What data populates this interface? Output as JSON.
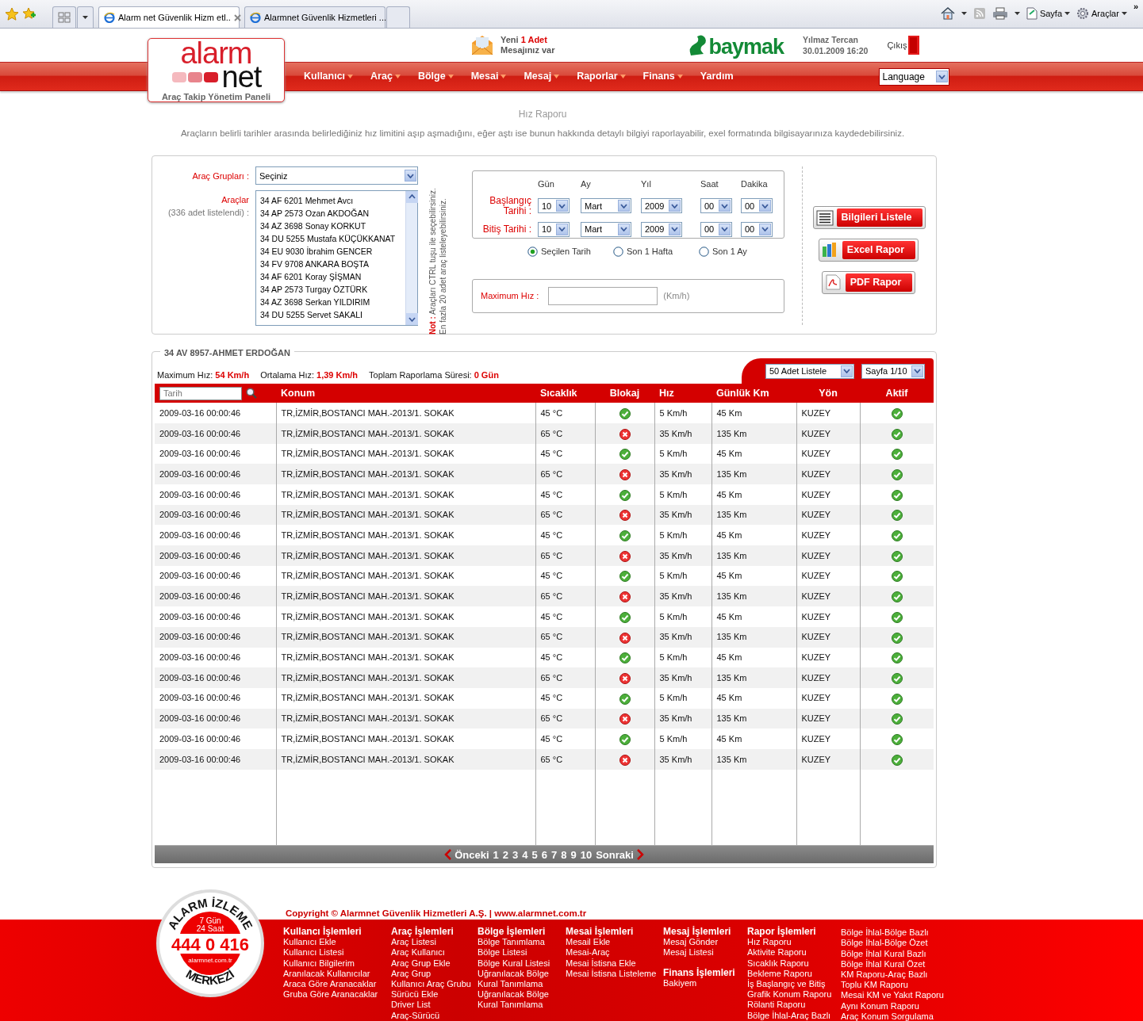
{
  "browser": {
    "tabs": [
      {
        "title": "Alarm net  Güvenlik Hizm etl..",
        "selected": true
      },
      {
        "title": "Alarmnet Güvenlik Hizmetleri ...",
        "selected": false
      }
    ],
    "tools": [
      "Sayfa",
      "Araçlar"
    ],
    "overflow": "»"
  },
  "header": {
    "logo": {
      "top": "alarm",
      "bottom": "net",
      "tagline": "Araç Takip Yönetim Paneli"
    },
    "message": {
      "prefix": "Yeni",
      "count": "1 Adet",
      "line2": "Mesajınız var"
    },
    "partner": "baymak",
    "user": {
      "name": "Yılmaz Tercan",
      "datetime": "30.01.2009 16:20"
    },
    "logout": "Çıkış"
  },
  "nav": {
    "items": [
      {
        "label": "Kullanıcı",
        "has_menu": true
      },
      {
        "label": "Araç",
        "has_menu": true
      },
      {
        "label": "Bölge",
        "has_menu": true
      },
      {
        "label": "Mesai",
        "has_menu": true
      },
      {
        "label": "Mesaj",
        "has_menu": true
      },
      {
        "label": "Raporlar",
        "has_menu": true
      },
      {
        "label": "Finans",
        "has_menu": true
      },
      {
        "label": "Yardım",
        "has_menu": false
      }
    ],
    "language": "Language"
  },
  "page": {
    "title": "Hız Raporu",
    "description": "Araçların belirli tarihler arasında belirlediğiniz hız limitini aşıp aşmadığını, eğer aştı ise bunun hakkında detaylı bilgiyi raporlayabilir, exel formatında bilgisayarınıza kaydedebilirsiniz."
  },
  "filter": {
    "groups_label": "Araç Grupları :",
    "groups_value": "Seçiniz",
    "vehicles_label": "Araçlar",
    "vehicles_count": "(336 adet listelendi) :",
    "vehicles": [
      "34 AF 6201 Mehmet Avcı",
      "34 AP 2573 Ozan AKDOĞAN",
      "34 AZ 3698 Sonay KORKUT",
      "34 DU 5255 Mustafa KÜÇÜKKANAT",
      "34 EU 9030 İbrahim GENCER",
      "34 FV 9708 ANKARA BOŞTA",
      "34 AF 6201 Koray ŞİŞMAN",
      "34 AP 2573 Turgay ÖZTÜRK",
      "34 AZ 3698 Serkan YILDIRIM",
      "34 DU 5255 Servet SAKALI"
    ],
    "note": [
      "**Not :** Araçları CTRL tuşu ile seçebilirsiniz.",
      "En fazla 20 adet araç listeleyebilirsiniz."
    ],
    "date_columns": [
      "Gün",
      "Ay",
      "Yıl",
      "Saat",
      "Dakika"
    ],
    "start_label": "Başlangıç Tarihi :",
    "start": [
      "10",
      "Mart",
      "2009",
      "00",
      "00"
    ],
    "end_label": "Bitiş Tarihi :",
    "end": [
      "10",
      "Mart",
      "2009",
      "00",
      "00"
    ],
    "ranges": [
      {
        "label": "Seçilen Tarih",
        "selected": true
      },
      {
        "label": "Son 1 Hafta",
        "selected": false
      },
      {
        "label": "Son 1 Ay",
        "selected": false
      }
    ],
    "max_speed_label": "Maximum Hız :",
    "max_speed_unit": "(Km/h)",
    "buttons": [
      {
        "kind": "list",
        "label": "Bilgileri Listele"
      },
      {
        "kind": "excel",
        "label": "Excel Rapor"
      },
      {
        "kind": "pdf",
        "label": "PDF Rapor"
      }
    ]
  },
  "results": {
    "title": "34 AV 8957-AHMET ERDOĞAN",
    "stats": [
      {
        "label": "Maximum Hız:",
        "value": "54 Km/h"
      },
      {
        "label": "Ortalama Hız:",
        "value": "1,39 Km/h"
      },
      {
        "label": "Toplam Raporlama Süresi:",
        "value": "0 Gün"
      }
    ],
    "page_size": "50 Adet Listele",
    "page_select": "Sayfa 1/10",
    "search_placeholder": "Tarih",
    "columns": [
      "Konum",
      "Sıcaklık",
      "Blokaj",
      "Hız",
      "Günlük Km",
      "Yön",
      "Aktif"
    ],
    "rows": [
      {
        "date": "2009-03-16 00:00:46",
        "location": "TR,İZMİR,BOSTANCI MAH.-2013/1. SOKAK",
        "temp": "45 °C",
        "blocked": false,
        "speed": "5 Km/h",
        "km": "45 Km",
        "direction": "KUZEY",
        "active": true
      },
      {
        "date": "2009-03-16 00:00:46",
        "location": "TR,İZMİR,BOSTANCI MAH.-2013/1. SOKAK",
        "temp": "65 °C",
        "blocked": true,
        "speed": "35 Km/h",
        "km": "135 Km",
        "direction": "KUZEY",
        "active": true
      },
      {
        "date": "2009-03-16 00:00:46",
        "location": "TR,İZMİR,BOSTANCI MAH.-2013/1. SOKAK",
        "temp": "45 °C",
        "blocked": false,
        "speed": "5 Km/h",
        "km": "45 Km",
        "direction": "KUZEY",
        "active": true
      },
      {
        "date": "2009-03-16 00:00:46",
        "location": "TR,İZMİR,BOSTANCI MAH.-2013/1. SOKAK",
        "temp": "65 °C",
        "blocked": true,
        "speed": "35 Km/h",
        "km": "135 Km",
        "direction": "KUZEY",
        "active": true
      },
      {
        "date": "2009-03-16 00:00:46",
        "location": "TR,İZMİR,BOSTANCI MAH.-2013/1. SOKAK",
        "temp": "45 °C",
        "blocked": false,
        "speed": "5 Km/h",
        "km": "45 Km",
        "direction": "KUZEY",
        "active": true
      },
      {
        "date": "2009-03-16 00:00:46",
        "location": "TR,İZMİR,BOSTANCI MAH.-2013/1. SOKAK",
        "temp": "65 °C",
        "blocked": true,
        "speed": "35 Km/h",
        "km": "135 Km",
        "direction": "KUZEY",
        "active": true
      },
      {
        "date": "2009-03-16 00:00:46",
        "location": "TR,İZMİR,BOSTANCI MAH.-2013/1. SOKAK",
        "temp": "45 °C",
        "blocked": false,
        "speed": "5 Km/h",
        "km": "45 Km",
        "direction": "KUZEY",
        "active": true
      },
      {
        "date": "2009-03-16 00:00:46",
        "location": "TR,İZMİR,BOSTANCI MAH.-2013/1. SOKAK",
        "temp": "65 °C",
        "blocked": true,
        "speed": "35 Km/h",
        "km": "135 Km",
        "direction": "KUZEY",
        "active": true
      },
      {
        "date": "2009-03-16 00:00:46",
        "location": "TR,İZMİR,BOSTANCI MAH.-2013/1. SOKAK",
        "temp": "45 °C",
        "blocked": false,
        "speed": "5 Km/h",
        "km": "45 Km",
        "direction": "KUZEY",
        "active": true
      },
      {
        "date": "2009-03-16 00:00:46",
        "location": "TR,İZMİR,BOSTANCI MAH.-2013/1. SOKAK",
        "temp": "65 °C",
        "blocked": true,
        "speed": "35 Km/h",
        "km": "135 Km",
        "direction": "KUZEY",
        "active": true
      },
      {
        "date": "2009-03-16 00:00:46",
        "location": "TR,İZMİR,BOSTANCI MAH.-2013/1. SOKAK",
        "temp": "45 °C",
        "blocked": false,
        "speed": "5 Km/h",
        "km": "45 Km",
        "direction": "KUZEY",
        "active": true
      },
      {
        "date": "2009-03-16 00:00:46",
        "location": "TR,İZMİR,BOSTANCI MAH.-2013/1. SOKAK",
        "temp": "65 °C",
        "blocked": true,
        "speed": "35 Km/h",
        "km": "135 Km",
        "direction": "KUZEY",
        "active": true
      },
      {
        "date": "2009-03-16 00:00:46",
        "location": "TR,İZMİR,BOSTANCI MAH.-2013/1. SOKAK",
        "temp": "45 °C",
        "blocked": false,
        "speed": "5 Km/h",
        "km": "45 Km",
        "direction": "KUZEY",
        "active": true
      },
      {
        "date": "2009-03-16 00:00:46",
        "location": "TR,İZMİR,BOSTANCI MAH.-2013/1. SOKAK",
        "temp": "65 °C",
        "blocked": true,
        "speed": "35 Km/h",
        "km": "135 Km",
        "direction": "KUZEY",
        "active": true
      },
      {
        "date": "2009-03-16 00:00:46",
        "location": "TR,İZMİR,BOSTANCI MAH.-2013/1. SOKAK",
        "temp": "45 °C",
        "blocked": false,
        "speed": "5 Km/h",
        "km": "45 Km",
        "direction": "KUZEY",
        "active": true
      },
      {
        "date": "2009-03-16 00:00:46",
        "location": "TR,İZMİR,BOSTANCI MAH.-2013/1. SOKAK",
        "temp": "65 °C",
        "blocked": true,
        "speed": "35 Km/h",
        "km": "135 Km",
        "direction": "KUZEY",
        "active": true
      },
      {
        "date": "2009-03-16 00:00:46",
        "location": "TR,İZMİR,BOSTANCI MAH.-2013/1. SOKAK",
        "temp": "45 °C",
        "blocked": false,
        "speed": "5 Km/h",
        "km": "45 Km",
        "direction": "KUZEY",
        "active": true
      },
      {
        "date": "2009-03-16 00:00:46",
        "location": "TR,İZMİR,BOSTANCI MAH.-2013/1. SOKAK",
        "temp": "65 °C",
        "blocked": true,
        "speed": "35 Km/h",
        "km": "135 Km",
        "direction": "KUZEY",
        "active": true
      }
    ],
    "pagination": {
      "prev": "Önceki",
      "pages": [
        "1",
        "2",
        "3",
        "4",
        "5",
        "6",
        "7",
        "8",
        "9",
        "10"
      ],
      "next": "Sonraki"
    }
  },
  "footer": {
    "badge": {
      "top": "ALARM İZLEME",
      "days": "7 Gün",
      "hours": "24 Saat",
      "phone": "444 0 416",
      "site": "alarmnet.com.tr",
      "bottom": "MERKEZİ"
    },
    "copyright": "Copyright © Alarmnet Güvenlik Hizmetleri A.Ş. | www.alarmnet.com.tr",
    "columns": [
      [
        {
          "title": "Kullancı İşlemleri",
          "links": [
            "Kullanıcı Ekle",
            "Kullanıcı Listesi",
            "Kullanıcı Bilgilerim",
            "Aranılacak Kullanıcılar",
            "Araca Göre Aranacaklar",
            "Gruba Göre Aranacaklar"
          ]
        }
      ],
      [
        {
          "title": "Araç İşlemleri",
          "links": [
            "Araç Listesi",
            "Araç Kullanıcı",
            "Araç Grup Ekle",
            "Araç Grup",
            "Kullanıcı Araç Grubu",
            "Sürücü Ekle",
            "Driver List",
            "Araç-Sürücü"
          ]
        }
      ],
      [
        {
          "title": "Bölge İşlemleri",
          "links": [
            "Bölge Tanımlama",
            "Bölge Listesi",
            "Bölge Kural Listesi",
            "Uğranılacak Bölge",
            "Kural Tanımlama",
            "Uğranılacak Bölge",
            "Kural Tanımlama"
          ]
        }
      ],
      [
        {
          "title": "Mesai İşlemleri",
          "links": [
            "Mesail Ekle",
            "Mesai-Araç",
            "Mesai İstisna Ekle",
            "Mesai İstisna Listeleme"
          ]
        }
      ],
      [
        {
          "title": "Mesaj İşlemleri",
          "links": [
            "Mesaj Gönder",
            "Mesaj Listesi"
          ]
        },
        {
          "title": "Finans İşlemleri",
          "links": [
            "Bakiyem"
          ]
        }
      ],
      [
        {
          "title": "Rapor İşlemleri",
          "links": [
            "Hız Raporu",
            "Aktivite Raporu",
            "Sıcaklık Raporu",
            "Bekleme Raporu",
            "İş Başlangıç ve Bitiş",
            "Grafik Konum Raporu",
            "Rölanti Raporu",
            "Bölge İhlal-Araç Bazlı"
          ]
        }
      ],
      [
        {
          "links": [
            "Bölge İhlal-Bölge Bazlı",
            "Bölge İhlal-Bölge Özet",
            "Bölge İhlal Kural Bazlı",
            "Bölge İhlal Kural Özet",
            "KM Raporu-Araç Bazlı",
            "Toplu KM Raporu",
            "Mesai KM ve Yakıt Raporu",
            "Aynı Konum Raporu",
            "Araç Konum Sorgulama"
          ]
        }
      ]
    ]
  }
}
